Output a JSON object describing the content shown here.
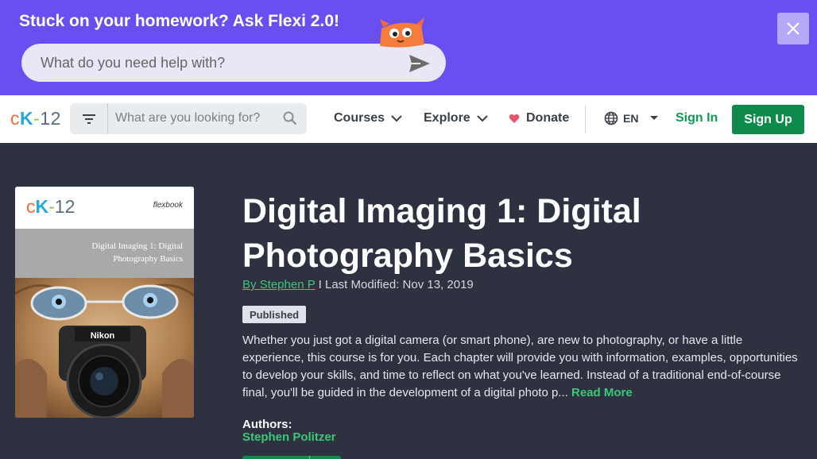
{
  "promo": {
    "title": "Stuck on your homework? Ask Flexi 2.0!",
    "placeholder": "What do you need help with?",
    "close_label": "×"
  },
  "nav": {
    "logo": {
      "c": "c",
      "k": "K",
      "dash": "-",
      "num": "12"
    },
    "search_placeholder": "What are you looking for?",
    "courses": "Courses",
    "explore": "Explore",
    "donate": "Donate",
    "language": "EN",
    "signin": "Sign In",
    "signup": "Sign Up"
  },
  "book": {
    "cover": {
      "flexbook": "flexbook",
      "band_title": "Digital Imaging 1: Digital Photography Basics"
    },
    "title": "Digital Imaging 1: Digital Photography Basics",
    "author_link": "By Stephen P",
    "modified": " I Last Modified: Nov 13, 2019",
    "status": "Published",
    "description": "Whether you just got a digital camera (or smart phone), are new to photography, or have a little experience, this course is for you. Each chapter will provide you with information, examples, opportunities to develop your skills, and time to reflect on what you've learned. Instead of a traditional end-of-course final, you'll be guided in the development of a digital photo p...",
    "read_more": " Read More",
    "authors_label": "Authors:",
    "author_name": "Stephen Politzer"
  },
  "colors": {
    "banner": "#6a4ff0",
    "background": "#2d3140",
    "accent_green": "#0e8a4a",
    "link_green": "#3cc77a"
  },
  "icons": [
    "send-icon",
    "mascot-icon",
    "close-icon",
    "filter-icon",
    "search-icon",
    "chevron-down-icon",
    "heart-icon",
    "globe-icon",
    "caret-down-icon"
  ]
}
